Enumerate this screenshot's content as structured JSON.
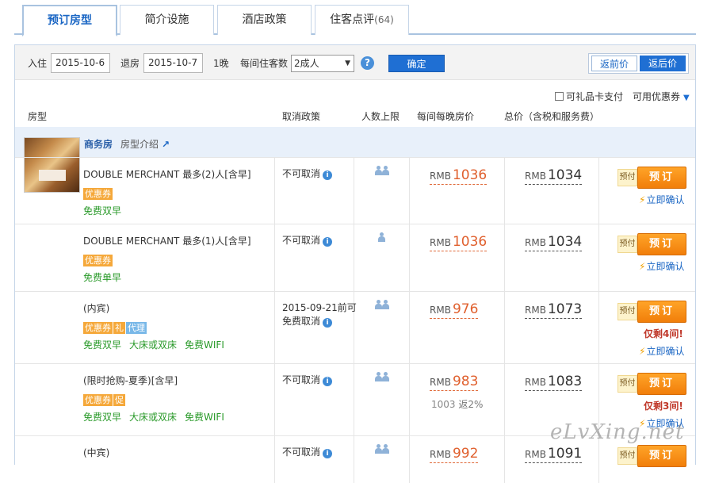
{
  "tabs": [
    {
      "label": "预订房型",
      "count": ""
    },
    {
      "label": "简介设施",
      "count": ""
    },
    {
      "label": "酒店政策",
      "count": ""
    },
    {
      "label": "住客点评",
      "count": "(64)"
    }
  ],
  "filter": {
    "checkin_label": "入住",
    "checkin_value": "2015-10-6",
    "checkout_label": "退房",
    "checkout_value": "2015-10-7",
    "nights": "1晚",
    "guests_label": "每间住客数",
    "guests_value": "2成人",
    "confirm_label": "确定",
    "price_before_label": "返前价",
    "price_after_label": "返后价"
  },
  "options": {
    "gift_card_label": "可礼品卡支付",
    "coupon_label": "可用优惠券"
  },
  "headers": {
    "room_type": "房型",
    "cancel_policy": "取消政策",
    "max_people": "人数上限",
    "nightly_price": "每间每晚房价",
    "total_price": "总价（含税和服务费）"
  },
  "room_group": {
    "name": "商务房",
    "intro_label": "房型介绍"
  },
  "rows": [
    {
      "name": "DOUBLE MERCHANT 最多(2)人[含早]",
      "tags": [
        "优惠券"
      ],
      "perks": [
        "免费双早"
      ],
      "cancel": "不可取消",
      "cancel2": "",
      "people": 2,
      "currency": "RMB",
      "price": "1036",
      "rebate_base": "",
      "rebate": "",
      "total": "1034",
      "prepay": "预付",
      "book": "预订",
      "remaining": "",
      "confirm": "立即确认"
    },
    {
      "name": "DOUBLE MERCHANT 最多(1)人[含早]",
      "tags": [
        "优惠券"
      ],
      "perks": [
        "免费单早"
      ],
      "cancel": "不可取消",
      "cancel2": "",
      "people": 1,
      "currency": "RMB",
      "price": "1036",
      "rebate_base": "",
      "rebate": "",
      "total": "1034",
      "prepay": "预付",
      "book": "预订",
      "remaining": "",
      "confirm": "立即确认"
    },
    {
      "name": "(内宾)",
      "tags": [
        "优惠券",
        "礼",
        "代理"
      ],
      "perks": [
        "免费双早",
        "大床或双床",
        "免费WIFI"
      ],
      "cancel": "2015-09-21前可",
      "cancel2": "免费取消",
      "people": 2,
      "currency": "RMB",
      "price": "976",
      "rebate_base": "",
      "rebate": "",
      "total": "1073",
      "prepay": "预付",
      "book": "预订",
      "remaining": "仅剩4间!",
      "confirm": "立即确认"
    },
    {
      "name": "(限时抢购-夏季)[含早]",
      "tags": [
        "优惠券",
        "促"
      ],
      "perks": [
        "免费双早",
        "大床或双床",
        "免费WIFI"
      ],
      "cancel": "不可取消",
      "cancel2": "",
      "people": 2,
      "currency": "RMB",
      "price": "983",
      "rebate_base": "1003",
      "rebate": "返2%",
      "total": "1083",
      "prepay": "预付",
      "book": "预订",
      "remaining": "仅剩3间!",
      "confirm": "立即确认"
    },
    {
      "name": "(中宾)",
      "tags": [],
      "perks": [],
      "cancel": "不可取消",
      "cancel2": "",
      "people": 2,
      "currency": "RMB",
      "price": "992",
      "rebate_base": "",
      "rebate": "",
      "total": "1091",
      "prepay": "预付",
      "book": "预订",
      "remaining": "",
      "confirm": ""
    }
  ],
  "watermark": "eLvXing.net",
  "colors": {
    "accent_blue": "#1f6fd3",
    "book_orange": "#f17e0a",
    "price_orange": "#e0602e",
    "perk_green": "#2a9a2a"
  }
}
